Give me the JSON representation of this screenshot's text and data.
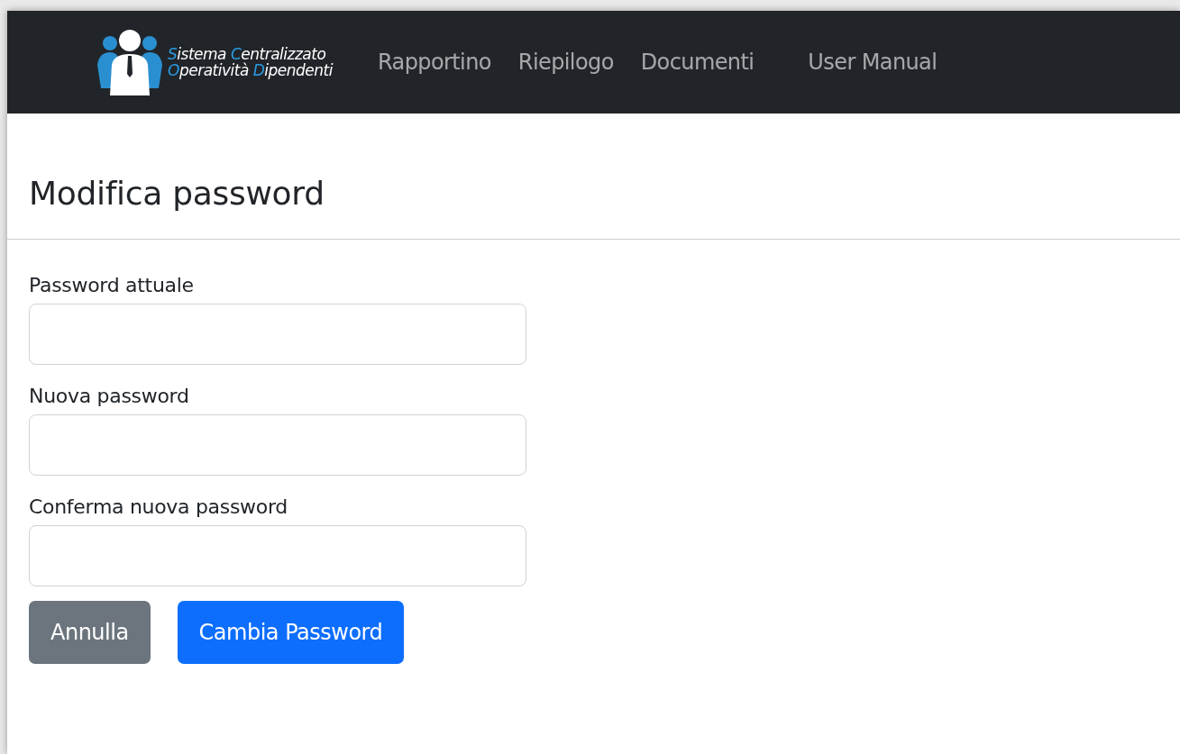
{
  "navbar": {
    "logo_lines": [
      [
        "Sistema",
        "Centralizzato"
      ],
      [
        "Operatività",
        "Dipendenti"
      ]
    ],
    "links": [
      "Rapportino",
      "Riepilogo",
      "Documenti",
      "User Manual"
    ]
  },
  "page": {
    "title": "Modifica password",
    "fields": [
      {
        "label": "Password attuale"
      },
      {
        "label": "Nuova password"
      },
      {
        "label": "Conferma nuova password"
      }
    ],
    "buttons": [
      {
        "kind": "secondary",
        "label": "Annulla"
      },
      {
        "kind": "primary",
        "label": "Cambia Password"
      }
    ]
  }
}
